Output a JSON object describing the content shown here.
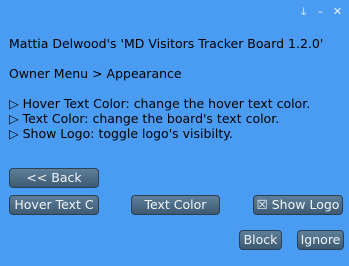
{
  "window": {
    "controls": [
      "⤓",
      "–",
      "✕"
    ],
    "background_color": "#4a9cf2"
  },
  "header": {
    "title": "Mattia Delwood's 'MD Visitors Tracker Board 1.2.0'",
    "breadcrumb": "Owner Menu > Appearance"
  },
  "help": {
    "items": [
      "▷ Hover Text Color: change the hover text color.",
      "▷ Text Color: change the board's text color.",
      "▷ Show Logo: toggle logo's visibilty."
    ]
  },
  "buttons": {
    "back": "<< Back",
    "hover_text": "Hover Text C",
    "text_color": "Text Color",
    "show_logo": "☒ Show Logo",
    "block": "Block",
    "ignore": "Ignore"
  }
}
